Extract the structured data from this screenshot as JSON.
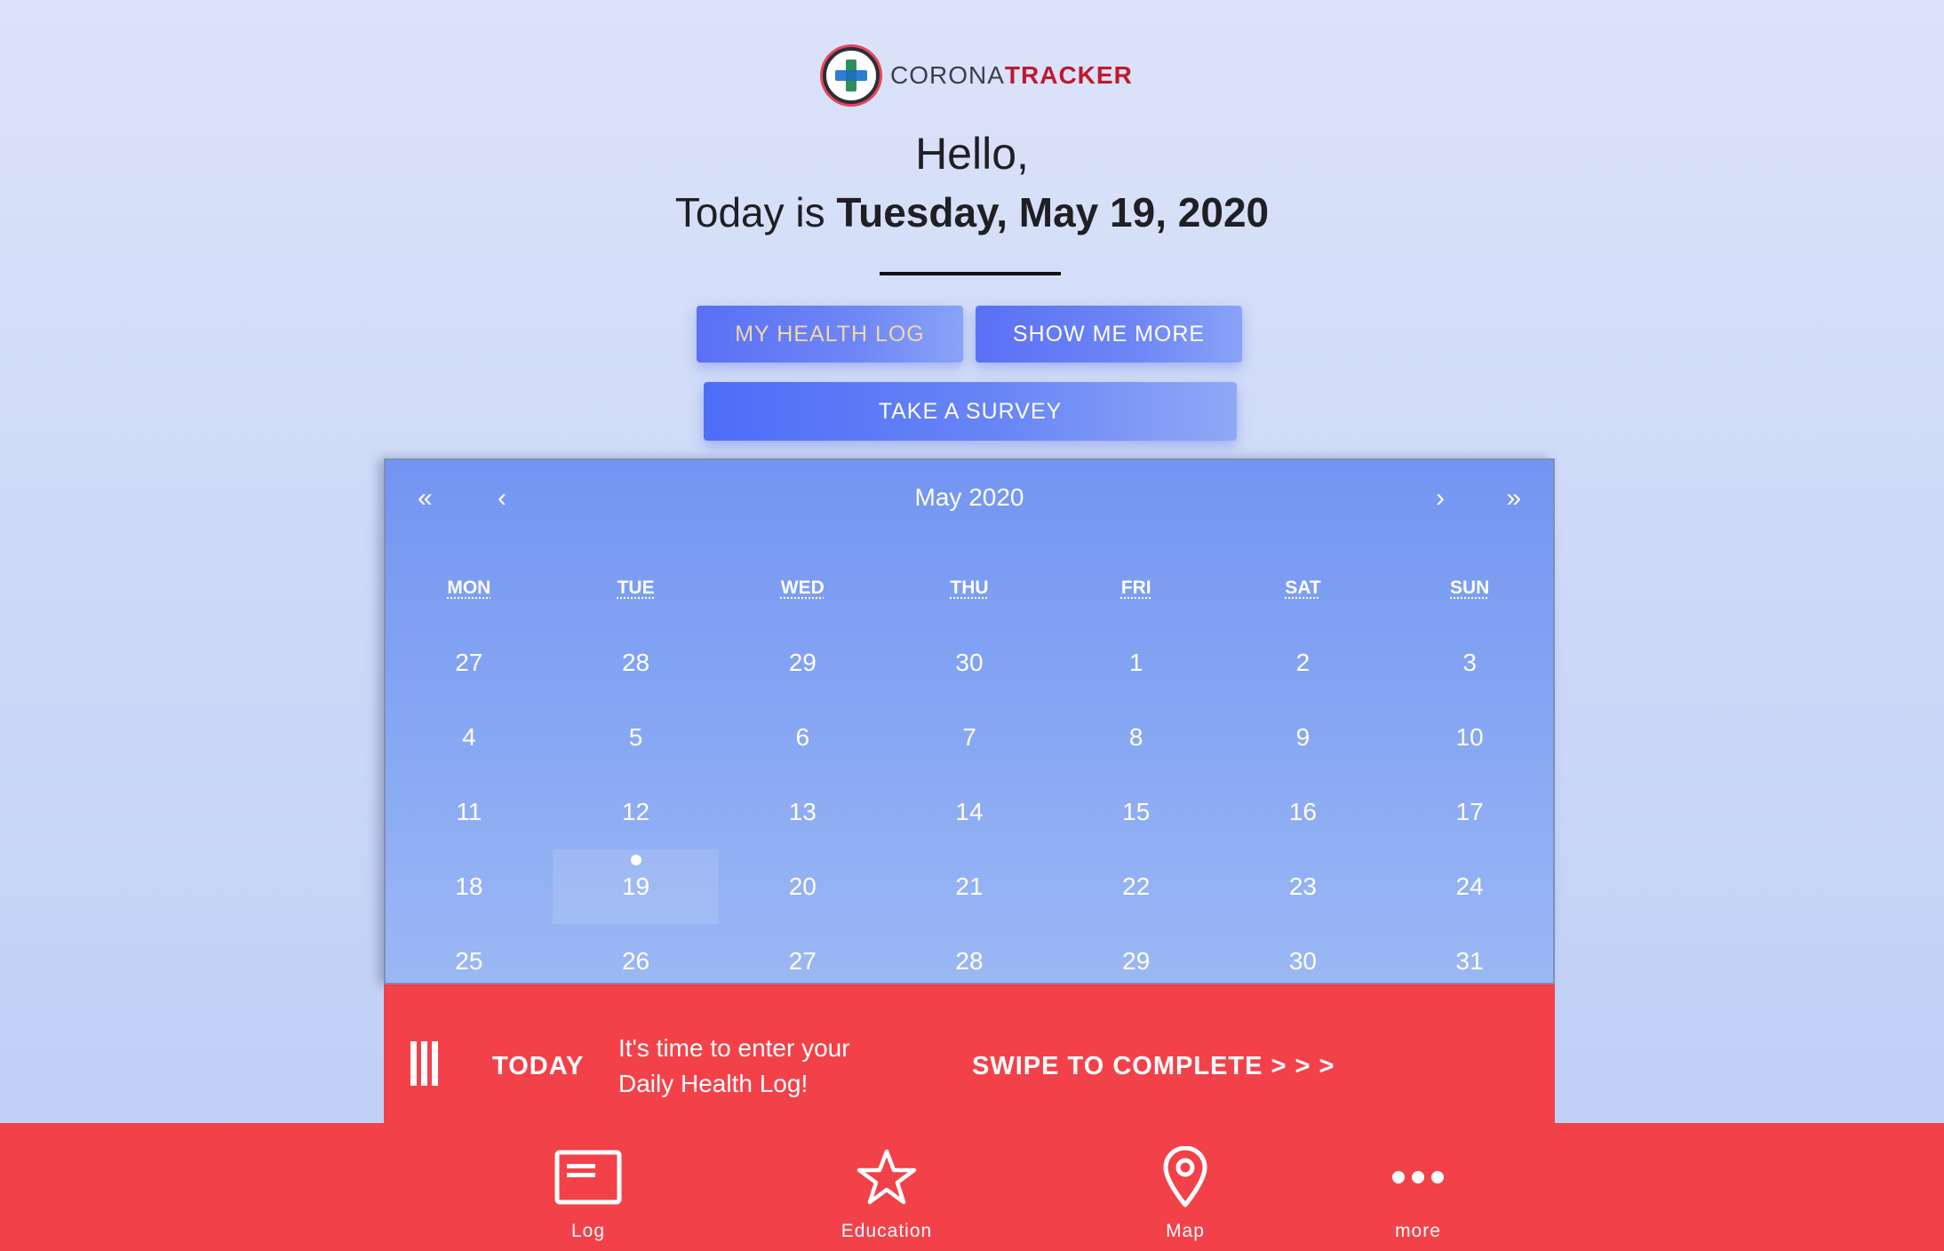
{
  "brand": {
    "name_light": "CORONA",
    "name_bold": "TRACKER",
    "suffix": "",
    "icon": "plus-logo-icon",
    "colors": {
      "accent": "#c0182f",
      "ring": "#e8455d"
    }
  },
  "greeting": {
    "hello": "Hello,",
    "today_prefix": "Today is ",
    "date": "Tuesday, May 19, 2020"
  },
  "buttons": {
    "health_log": "MY HEALTH LOG",
    "show_more": "SHOW ME MORE",
    "survey": "TAKE A SURVEY"
  },
  "calendar": {
    "nav": {
      "prev_year": "«",
      "prev": "‹",
      "next": "›",
      "next_year": "»"
    },
    "month_label": "May 2020",
    "weekdays": [
      "MON",
      "TUE",
      "WED",
      "THU",
      "FRI",
      "SAT",
      "SUN"
    ],
    "weeks": [
      [
        "27",
        "28",
        "29",
        "30",
        "1",
        "2",
        "3"
      ],
      [
        "4",
        "5",
        "6",
        "7",
        "8",
        "9",
        "10"
      ],
      [
        "11",
        "12",
        "13",
        "14",
        "15",
        "16",
        "17"
      ],
      [
        "18",
        "19",
        "20",
        "21",
        "22",
        "23",
        "24"
      ],
      [
        "25",
        "26",
        "27",
        "28",
        "29",
        "30",
        "31"
      ]
    ],
    "selected": {
      "week": 3,
      "day": 1
    }
  },
  "reminder": {
    "label": "TODAY",
    "message": "It's time to enter your Daily Health Log!",
    "cta": "SWIPE TO COMPLETE > > >",
    "color": "#f34149"
  },
  "bottom_nav": {
    "tabs": [
      {
        "label": "Log",
        "icon": "log-icon"
      },
      {
        "label": "Education",
        "icon": "star-icon"
      },
      {
        "label": "Map",
        "icon": "map-pin-icon"
      },
      {
        "label": "more",
        "icon": "more-dots-icon"
      }
    ]
  }
}
